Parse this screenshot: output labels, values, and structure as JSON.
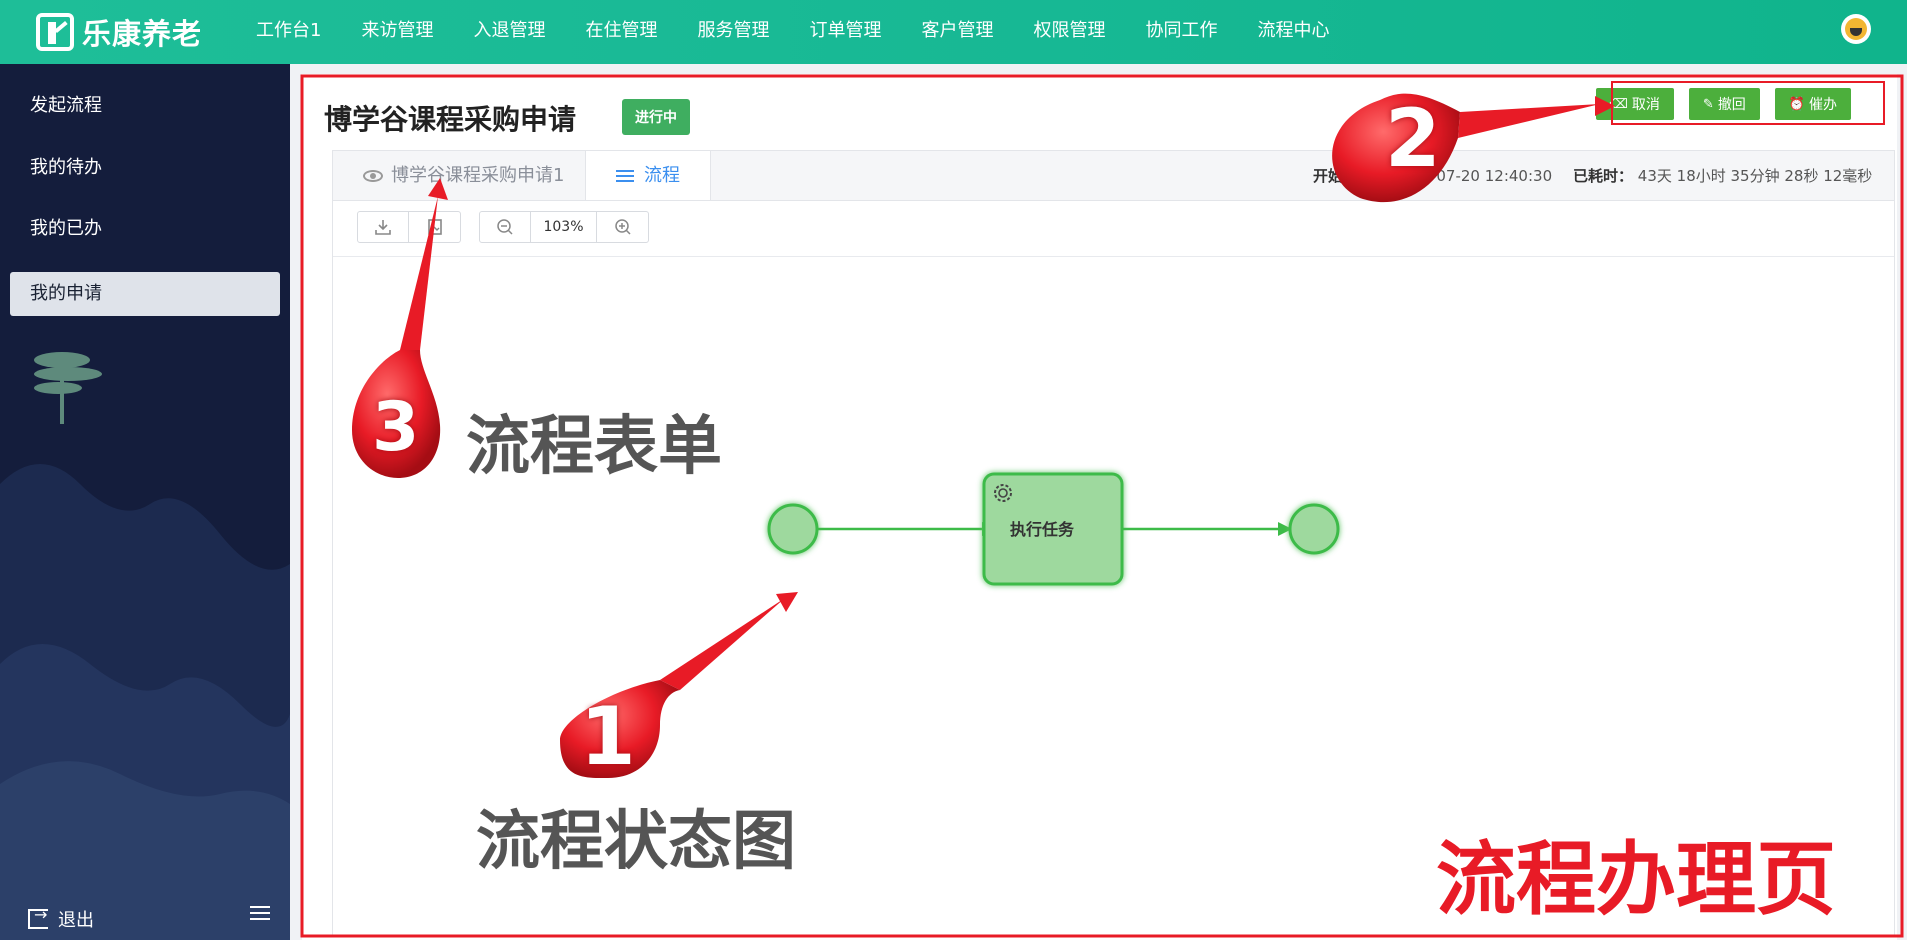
{
  "brand": {
    "name": "乐康养老"
  },
  "nav": [
    "工作台1",
    "来访管理",
    "入退管理",
    "在住管理",
    "服务管理",
    "订单管理",
    "客户管理",
    "权限管理",
    "协同工作",
    "流程中心"
  ],
  "sidebar": {
    "items": [
      {
        "label": "发起流程",
        "active": false
      },
      {
        "label": "我的待办",
        "active": false
      },
      {
        "label": "我的已办",
        "active": false
      },
      {
        "label": "我的申请",
        "active": true
      }
    ],
    "logout": "退出"
  },
  "page": {
    "title": "博学谷课程采购申请",
    "status": "进行中",
    "actions": [
      {
        "icon": "eraser-icon",
        "label": "取消"
      },
      {
        "icon": "edit-icon",
        "label": "撤回"
      },
      {
        "icon": "alarm-icon",
        "label": "催办"
      }
    ],
    "tabs": [
      {
        "label": "博学谷课程采购申请1",
        "icon": "eye-icon"
      },
      {
        "label": "流程",
        "icon": "sliders-icon"
      }
    ],
    "start_label": "开始时间：",
    "start_value": "2023-07-20 12:40:30",
    "elapsed_label": "已耗时：",
    "elapsed_value": "43天 18小时 35分钟 28秒 12毫秒",
    "zoom": "103%"
  },
  "diagram": {
    "task_label": "执行任务",
    "accent": "#3dbb48",
    "fill": "#9ed99e"
  },
  "annotations": {
    "n1": "1",
    "n2": "2",
    "n3": "3",
    "label1": "流程状态图",
    "label3": "流程表单",
    "page_label": "流程办理页"
  },
  "colors": {
    "topbar": "#17b894",
    "sidebar": "#141d3c",
    "button": "#4caf3c",
    "annotation": "#e81b26"
  }
}
